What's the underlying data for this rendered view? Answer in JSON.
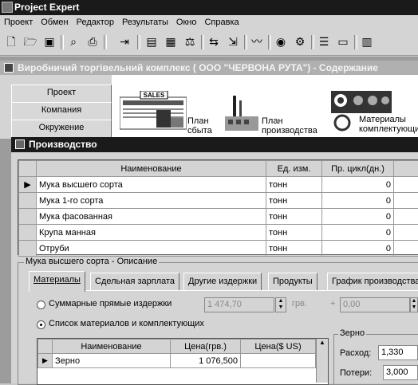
{
  "app": {
    "title": "Project Expert"
  },
  "menu": [
    "Проект",
    "Обмен",
    "Редактор",
    "Результаты",
    "Окно",
    "Справка"
  ],
  "toolbar": {
    "icons": [
      "new-icon",
      "open-icon",
      "save-icon",
      "preview-icon",
      "print-icon",
      "exit-icon",
      "calc-icon",
      "cashflow-icon",
      "balance-icon",
      "compare-icon",
      "export-icon",
      "chart-icon",
      "analysis-icon",
      "settings-icon",
      "list-icon",
      "report-icon",
      "table-icon"
    ]
  },
  "content_window": {
    "title": "Виробничий торгівельний комплекс ( ООО \"ЧЕРВОНА РУТА\") - Содержание",
    "nav": [
      "Проект",
      "Компания",
      "Окружение"
    ],
    "modules": [
      {
        "label_line1": "План",
        "label_line2": "сбыта",
        "image_text": "SALES"
      },
      {
        "label_line1": "План",
        "label_line2": "производства"
      },
      {
        "label_line1": "Материалы",
        "label_line2": "комплектующих"
      }
    ]
  },
  "production_window": {
    "title": "Производство",
    "table": {
      "columns": [
        "Наименование",
        "Ед. изм.",
        "Пр. цикл(дн.)"
      ],
      "rows": [
        {
          "name": "Мука высшего сорта",
          "unit": "тонн",
          "cycle": "0"
        },
        {
          "name": "Мука 1-го сорта",
          "unit": "тонн",
          "cycle": "0"
        },
        {
          "name": "Мука фасованная",
          "unit": "тонн",
          "cycle": "0"
        },
        {
          "name": "Крупа манная",
          "unit": "тонн",
          "cycle": "0"
        },
        {
          "name": "Отруби",
          "unit": "тонн",
          "cycle": "0"
        }
      ]
    },
    "description": {
      "label": "Мука высшего сорта - Описание",
      "tabs": [
        "Материалы",
        "Сдельная зарплата",
        "Другие издержки",
        "Продукты",
        "График производства"
      ],
      "options": {
        "summary_label": "Суммарные прямые издержки",
        "summary_value": "1 474,70",
        "currency": "грв.",
        "plus_label": "+",
        "plus_value": "0,00",
        "list_label": "Список материалов и комплектующих"
      },
      "materials": {
        "columns": [
          "Наименование",
          "Цена(грв.)",
          "Цена($ US)"
        ],
        "rows": [
          {
            "name": "Зерно",
            "price_uah": "1 076,500",
            "price_usd": ""
          }
        ]
      },
      "detail": {
        "label": "Зерно",
        "consumption_label": "Расход:",
        "consumption_value": "1,330",
        "losses_label": "Потери:",
        "losses_value": "3,000"
      }
    }
  }
}
